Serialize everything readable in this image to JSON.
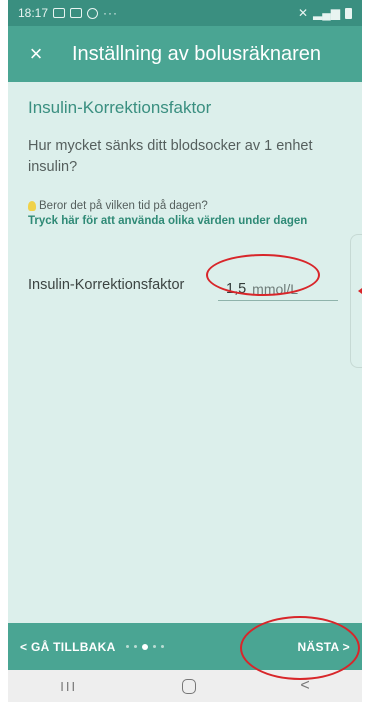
{
  "status_bar": {
    "time": "18:17",
    "more": "···"
  },
  "app_bar": {
    "close_icon": "×",
    "title": "Inställning av bolusräknaren"
  },
  "section": {
    "title": "Insulin-Korrektionsfaktor",
    "question": "Hur mycket sänks ditt blodsocker av 1 enhet insulin?",
    "hint_text": "Beror det på vilken tid på dagen?",
    "hint_link": "Tryck här för att använda olika värden under dagen"
  },
  "field": {
    "label": "Insulin-Korrektionsfaktor",
    "value": "1,5",
    "unit": "mmol/L"
  },
  "bottom_bar": {
    "back_label": "< GÅ TILLBAKA",
    "next_label": "NÄSTA >",
    "page_total": 5,
    "page_current": 3
  },
  "android_nav": {
    "recent": "III",
    "back": "<"
  },
  "colors": {
    "header": "#4aa593",
    "background": "#dcefeb",
    "accent": "#3a8f80",
    "annotation": "#d8262a"
  }
}
